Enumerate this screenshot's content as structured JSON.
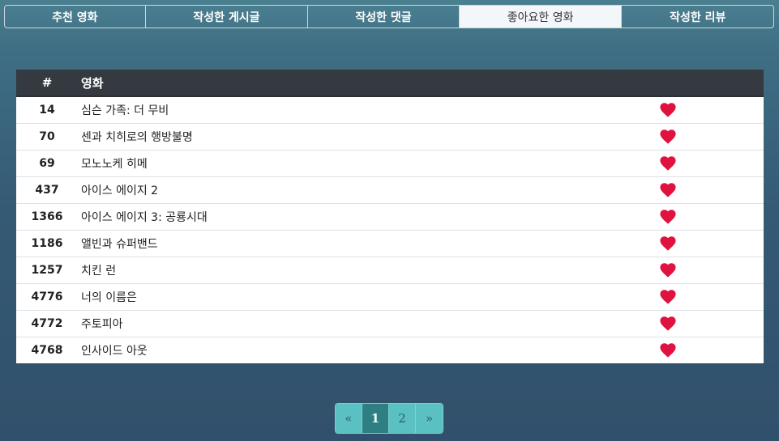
{
  "tabs": [
    {
      "label": "추천 영화",
      "active": false
    },
    {
      "label": "작성한 게시글",
      "active": false
    },
    {
      "label": "작성한 댓글",
      "active": false
    },
    {
      "label": "좋아요한 영화",
      "active": true
    },
    {
      "label": "작성한 리뷰",
      "active": false
    }
  ],
  "table": {
    "headers": {
      "num": "#",
      "title": "영화"
    },
    "rows": [
      {
        "id": "14",
        "title": "심슨 가족: 더 무비"
      },
      {
        "id": "70",
        "title": "센과 치히로의 행방불명"
      },
      {
        "id": "69",
        "title": "모노노케 히메"
      },
      {
        "id": "437",
        "title": "아이스 에이지 2"
      },
      {
        "id": "1366",
        "title": "아이스 에이지 3: 공룡시대"
      },
      {
        "id": "1186",
        "title": "앨빈과 슈퍼밴드"
      },
      {
        "id": "1257",
        "title": "치킨 런"
      },
      {
        "id": "4776",
        "title": "너의 이름은"
      },
      {
        "id": "4772",
        "title": "주토피아"
      },
      {
        "id": "4768",
        "title": "인사이드 아웃"
      }
    ],
    "heart_icon": "heart-icon",
    "heart_color": "#e0123f"
  },
  "pagination": {
    "prev": "«",
    "pages": [
      "1",
      "2"
    ],
    "current": "1",
    "next": "»"
  },
  "colors": {
    "header_bg": "#343a40",
    "pagination_bg": "#5bc0c2",
    "pagination_active": "#2d7f84"
  }
}
